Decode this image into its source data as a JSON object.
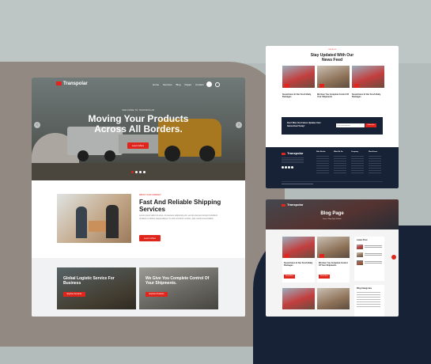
{
  "brand": {
    "name": "Transpolar",
    "accent": "#e0251d",
    "navy": "#182237"
  },
  "main": {
    "nav": [
      "Home",
      "Services",
      "Blog",
      "Pages",
      "Contact"
    ],
    "hero": {
      "eyebrow": "WELCOME TO TRANSPOLAR",
      "title_line1": "Moving Your Products",
      "title_line2": "Across All Borders.",
      "button": "Learn More"
    },
    "about": {
      "eyebrow": "ABOUT OUR COMPANY",
      "title_line1": "Fast And Reliable Shipping",
      "title_line2": "Services",
      "body": "Lorem ipsum dolor sit amet, consectetur adipiscing elit, sed do eiusmod tempor incididunt ut labore et dolore magna aliqua. Ut enim ad minim veniam, quis nostrud exercitation.",
      "button": "Learn More"
    },
    "cards": [
      {
        "title_line1": "Global Logistic Service For",
        "title_line2": "Business",
        "button": "Explore Services"
      },
      {
        "title_line1": "We Give You Complete Control Of",
        "title_line2": "Your Shipments.",
        "button": "Explore Products"
      }
    ]
  },
  "news": {
    "eyebrow": "OUR BLOG",
    "title_line1": "Stay Updated With Our",
    "title_line2": "News Feed",
    "posts": [
      {
        "title": "Sound Here In Our Fresh Daily Packages"
      },
      {
        "title": "We Give You Complete Control Of Your Shipments"
      },
      {
        "title": "Sound Here In Our Fresh Daily Packages"
      }
    ],
    "newsletter": {
      "title": "Don't Miss Our Future Updates! Get Subscribed Today!",
      "placeholder": "Your email address",
      "button": "Subscribe"
    },
    "footer_cols": [
      "Who We Are",
      "What We Do",
      "Company",
      "Work Hours"
    ]
  },
  "blog": {
    "title": "Blog Page",
    "breadcrumb": "Home  /  Blog Right Sidebar",
    "posts": [
      {
        "title": "Sound Here In Our Fresh Daily Packages",
        "button": "Read More"
      },
      {
        "title": "We Give You Complete Control Of Your Shipments",
        "button": "Read More"
      }
    ],
    "sidebar": {
      "latest": "Latest Post",
      "categories": "Blog Categories"
    }
  }
}
